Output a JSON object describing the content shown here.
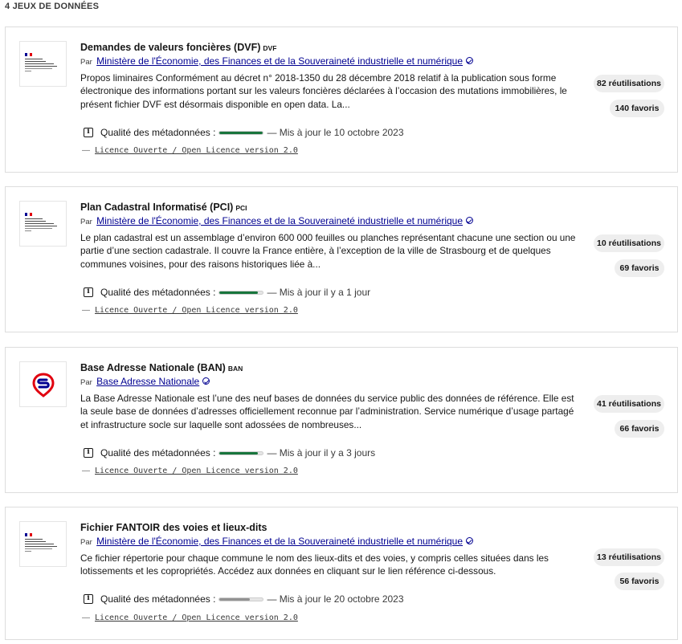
{
  "header": {
    "count_label": "4 JEUX DE DONNÉES"
  },
  "colors": {
    "link": "#000091",
    "quality_good": "#18753c",
    "quality_low": "#929292",
    "bar_track": "#e5e5e5"
  },
  "datasets": [
    {
      "logo": "marianne-logo",
      "title": "Demandes de valeurs foncières (DVF)",
      "acronym": "DVF",
      "by_label": "Par",
      "organization": "Ministère de l'Économie, des Finances et de la Souveraineté industrielle et numérique",
      "description": "Propos liminaires Conformément au décret n° 2018-1350 du 28 décembre 2018 relatif à la publication sous forme électronique des informations portant sur les valeurs foncières déclarées à l’occasion des mutations immobilières, le présent fichier DVF est désormais disponible en open data. La...",
      "quality_label": "Qualité des métadonnées :",
      "quality_level": 1.0,
      "updated": "— Mis à jour le 10 octobre 2023",
      "license_dash": "—",
      "license": "Licence Ouverte / Open Licence version 2.0",
      "reuses": "82 réutilisations",
      "favorites": "140 favoris"
    },
    {
      "logo": "marianne-logo",
      "title": "Plan Cadastral Informatisé (PCI)",
      "acronym": "PCI",
      "by_label": "Par",
      "organization": "Ministère de l'Économie, des Finances et de la Souveraineté industrielle et numérique",
      "description": "Le plan cadastral est un assemblage d’environ 600 000 feuilles ou planches représentant chacune une section ou une partie d’une section cadastrale. Il couvre la France entière, à l’exception de la ville de Strasbourg et de quelques communes voisines, pour des raisons historiques liée à...",
      "quality_label": "Qualité des métadonnées :",
      "quality_level": 0.88,
      "updated": "— Mis à jour il y a 1 jour",
      "license_dash": "—",
      "license": "Licence Ouverte / Open Licence version 2.0",
      "reuses": "10 réutilisations",
      "favorites": "69 favoris"
    },
    {
      "logo": "ban-logo",
      "title": "Base Adresse Nationale (BAN)",
      "acronym": "BAN",
      "by_label": "Par",
      "organization": "Base Adresse Nationale",
      "description": "La Base Adresse Nationale est l’une des neuf bases de données du service public des données de référence. Elle est la seule base de données d’adresses officiellement reconnue par l’administration. Service numérique d’usage partagé et infrastructure socle sur laquelle sont adossées de nombreuses...",
      "quality_label": "Qualité des métadonnées :",
      "quality_level": 0.88,
      "updated": "— Mis à jour il y a 3 jours",
      "license_dash": "—",
      "license": "Licence Ouverte / Open Licence version 2.0",
      "reuses": "41 réutilisations",
      "favorites": "66 favoris"
    },
    {
      "logo": "marianne-logo",
      "title": "Fichier FANTOIR des voies et lieux-dits",
      "acronym": "",
      "by_label": "Par",
      "organization": "Ministère de l'Économie, des Finances et de la Souveraineté industrielle et numérique",
      "description": "Ce fichier répertorie pour chaque commune le nom des lieux-dits et des voies, y compris celles situées dans les lotissements et les copropriétés. Accédez aux données en cliquant sur le lien référence ci-dessous.",
      "quality_label": "Qualité des métadonnées :",
      "quality_level": 0.7,
      "updated": "— Mis à jour le 20 octobre 2023",
      "license_dash": "—",
      "license": "Licence Ouverte / Open Licence version 2.0",
      "reuses": "13 réutilisations",
      "favorites": "56 favoris"
    }
  ]
}
